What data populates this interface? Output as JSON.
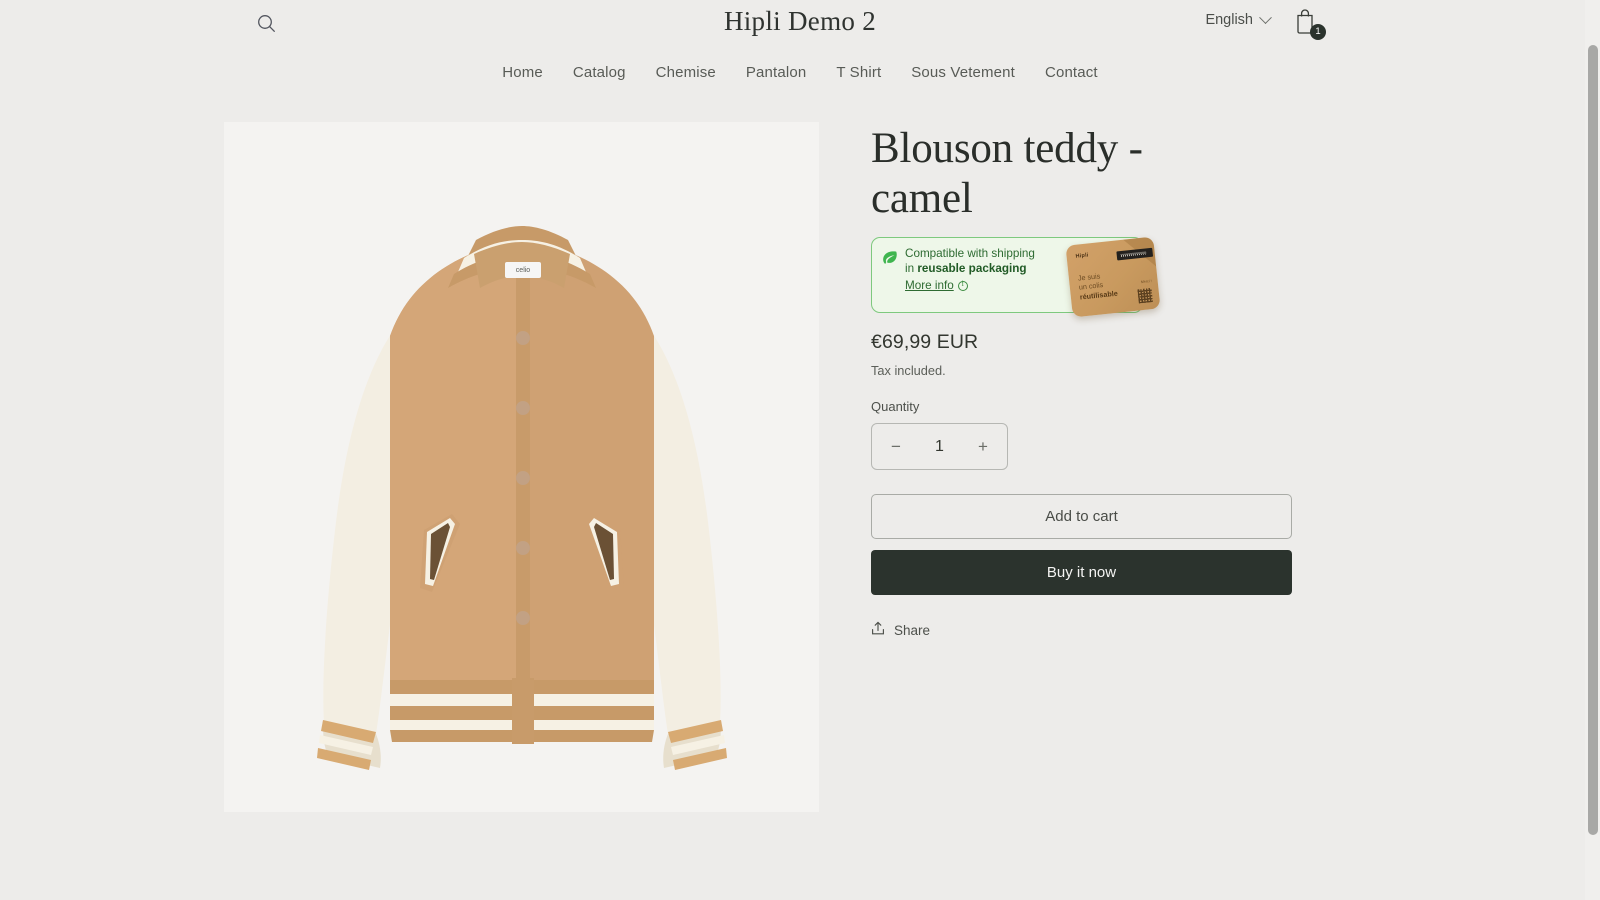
{
  "header": {
    "search_icon": "search-icon",
    "store_title": "Hipli Demo 2",
    "language": "English",
    "chevron_icon": "chevron-down-icon",
    "cart_icon": "shopping-bag-icon",
    "cart_count": "1"
  },
  "nav": {
    "items": [
      {
        "label": "Home"
      },
      {
        "label": "Catalog"
      },
      {
        "label": "Chemise"
      },
      {
        "label": "Pantalon"
      },
      {
        "label": "T Shirt"
      },
      {
        "label": "Sous Vetement"
      },
      {
        "label": "Contact"
      }
    ]
  },
  "product": {
    "title": "Blouson teddy - camel",
    "image_alt": "Camel and cream varsity teddy jacket, front view",
    "price": "€69,99 EUR",
    "tax_note": "Tax included.",
    "quantity_label": "Quantity",
    "quantity_value": "1",
    "decrease_label": "−",
    "increase_label": "+",
    "add_to_cart_label": "Add to cart",
    "buy_now_label": "Buy it now",
    "share_label": "Share",
    "share_icon": "share-icon"
  },
  "eco_banner": {
    "leaf_icon": "leaf-icon",
    "text_part1": "Compatible with shipping in ",
    "text_bold": "reusable packaging",
    "more_info_label": "More info",
    "info_icon": "info-circle-icon",
    "card": {
      "logo": "Hipli",
      "line1": "Je suis",
      "line2": "un colis",
      "line3": "réutilisable",
      "small_text": "Merci !",
      "qr_icon": "qr-code-icon"
    }
  },
  "colors": {
    "page_background": "#edecea",
    "gallery_background": "#f4f3f1",
    "eco_green_fill": "#eef7e9",
    "eco_green_border": "#7ec97e",
    "eco_green_text": "#2e6b32",
    "leaf_green": "#3fb54f",
    "buy_button": "#2b332d",
    "text_primary": "#32352f"
  }
}
